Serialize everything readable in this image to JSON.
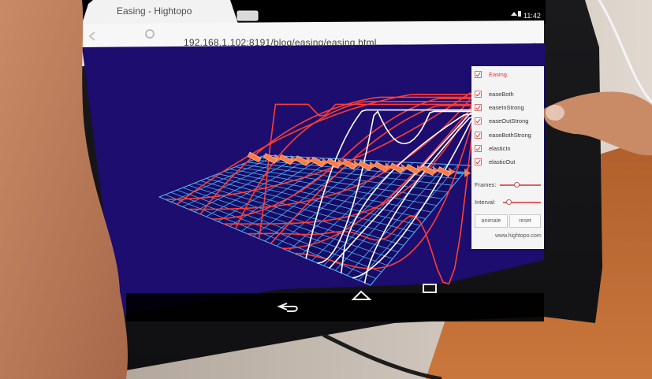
{
  "browser": {
    "tab_title": "Easing - Hightopo",
    "url": "192.168.1.102:8191/blog/easing/easing.html",
    "status_time": "11:42"
  },
  "panel": {
    "header_label": "Easing",
    "items": [
      {
        "label": "easeBoth",
        "checked": true
      },
      {
        "label": "easeInStrong",
        "checked": true
      },
      {
        "label": "easeOutStrong",
        "checked": true
      },
      {
        "label": "easeBothStrong",
        "checked": true
      },
      {
        "label": "elasticIn",
        "checked": true
      },
      {
        "label": "elasticOut",
        "checked": true
      }
    ],
    "frames_label": "Frames:",
    "interval_label": "Interval:",
    "animate_label": "animate",
    "reset_label": "reset",
    "footer_text": "www.hightopo.com"
  },
  "colors": {
    "viewport_bg": "#1c0d6e",
    "grid": "#54b2ff",
    "curves_hot": "#ff3d35",
    "curves_white": "#ffffff",
    "markers": "#ff7d45",
    "markers_blue": "#1fa6ff"
  },
  "icons": [
    "star-icon",
    "mic-icon",
    "menu-icon",
    "reload-icon",
    "back-icon",
    "home-icon",
    "recents-icon",
    "wifi-icon",
    "battery-icon"
  ]
}
